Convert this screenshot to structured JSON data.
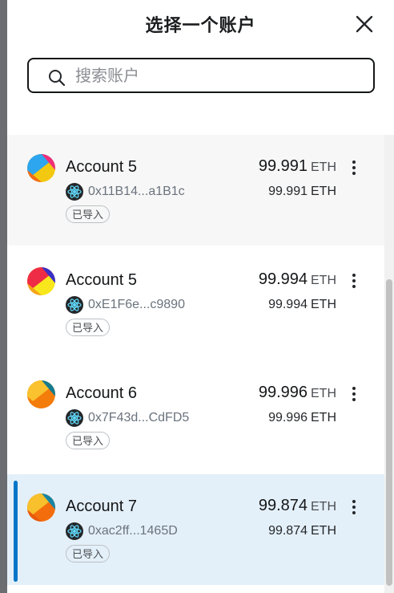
{
  "header": {
    "title": "选择一个账户"
  },
  "search": {
    "placeholder": "搜索账户",
    "value": ""
  },
  "accounts": [
    {
      "name": "Account 5",
      "address": "0x11B14...a1B1c",
      "balance": "99.991",
      "sub_balance": "99.991",
      "currency": "ETH",
      "badge": "已导入",
      "state": "hover",
      "avatar_colors": [
        "#f3c811",
        "#2da5ef",
        "#ef2f7a",
        "#f46b13"
      ]
    },
    {
      "name": "Account 5",
      "address": "0xE1F6e...c9890",
      "balance": "99.994",
      "sub_balance": "99.994",
      "currency": "ETH",
      "badge": "已导入",
      "state": "normal",
      "avatar_colors": [
        "#f8e71c",
        "#ef2c45",
        "#3a2fc5",
        "#f6a21a"
      ]
    },
    {
      "name": "Account 6",
      "address": "0x7F43d...CdFD5",
      "balance": "99.996",
      "sub_balance": "99.996",
      "currency": "ETH",
      "badge": "已导入",
      "state": "normal",
      "avatar_colors": [
        "#f37c0b",
        "#f9c22e",
        "#157b8d",
        "#f37c0b"
      ]
    },
    {
      "name": "Account 7",
      "address": "0xac2ff...1465D",
      "balance": "99.874",
      "sub_balance": "99.874",
      "currency": "ETH",
      "badge": "已导入",
      "state": "selected",
      "avatar_colors": [
        "#f46d0d",
        "#f7c02c",
        "#1785a2",
        "#e85a0c"
      ]
    }
  ],
  "icons": {
    "close": "close-icon",
    "search": "search-icon",
    "network": "network-icon",
    "menu": "kebab-menu-icon"
  },
  "colors": {
    "accent": "#0376c9",
    "selected_bg": "#e4f0f9",
    "hover_bg": "#f7f7f7"
  }
}
